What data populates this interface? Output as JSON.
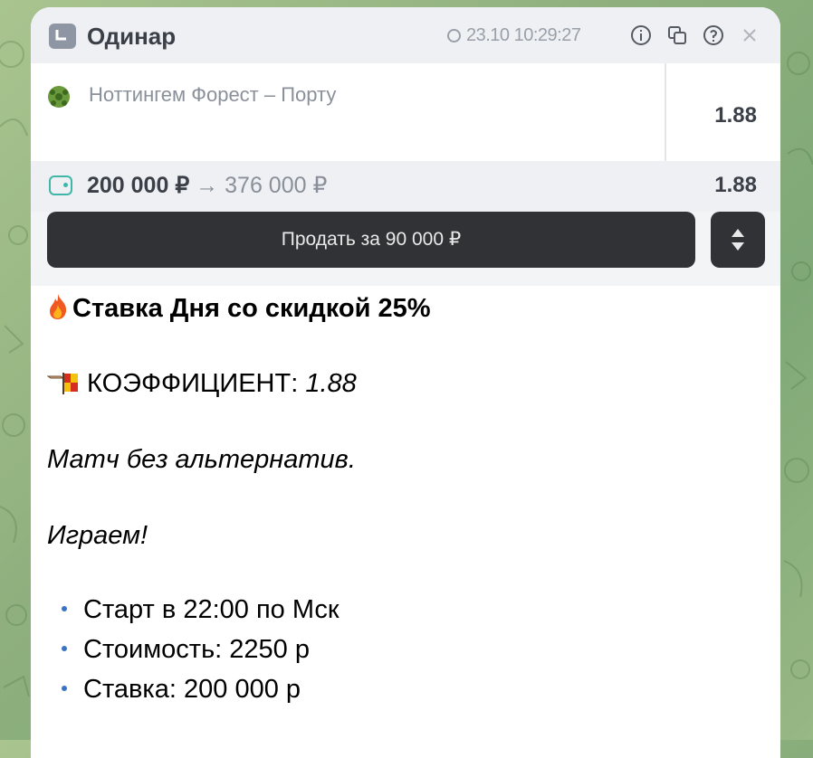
{
  "ticket": {
    "title": "Одинар",
    "datetime": "23.10  10:29:27",
    "match": "Ноттингем Форест – Порту",
    "odds": "1.88",
    "stake": "200 000 ₽",
    "arrow": " → ",
    "potential_win": "376 000 ₽",
    "total_odds": "1.88",
    "sell_label": "Продать за 90 000 ₽",
    "icons": [
      "clock-icon",
      "info-icon",
      "copy-icon",
      "help-icon",
      "close-icon",
      "ball-icon",
      "wallet-icon",
      "sort-icon"
    ]
  },
  "message": {
    "headline": "Ставка Дня со скидкой 25%",
    "coef_label": "КОЭФФИЦИЕНТ: ",
    "coef_value": "1.88",
    "note": "Матч без альтернатив.",
    "cta": "Играем!",
    "bullets": [
      "Старт в 22:00 по Мск",
      "Стоимость: 2250 р",
      "Ставка: 200 000 р"
    ]
  },
  "colors": {
    "chat_background": "#8fb07e",
    "bullet": "#3a74c0",
    "wallet_accent": "#3fb6a8",
    "button_dark": "#303235"
  }
}
